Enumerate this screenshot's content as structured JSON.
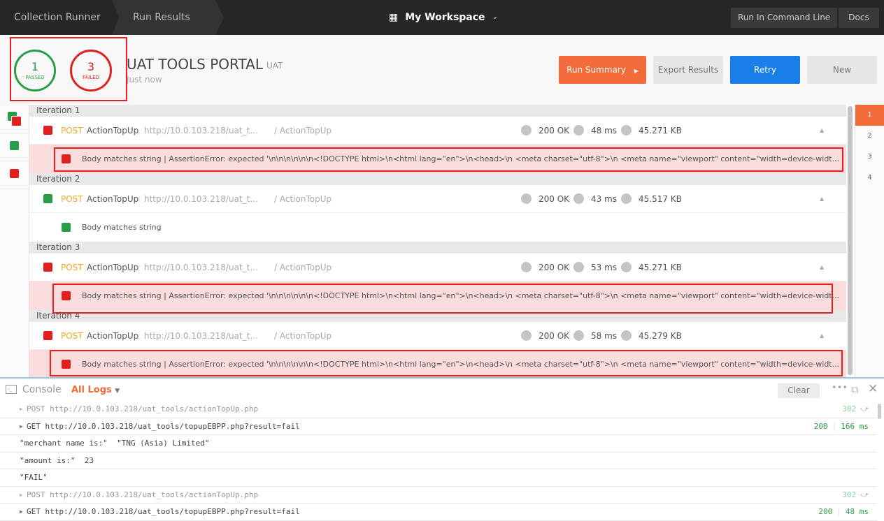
{
  "topbar": {
    "crumbs": [
      "Collection Runner",
      "Run Results"
    ],
    "workspace": "My Workspace",
    "run_cmd": "Run In Command Line",
    "docs": "Docs"
  },
  "summary": {
    "passed": "1",
    "passed_label": "PASSED",
    "failed": "3",
    "failed_label": "FAILED",
    "title": "UAT TOOLS PORTAL",
    "env": "UAT",
    "time": "Just now"
  },
  "buttons": {
    "run_summary": "Run Summary",
    "export": "Export Results",
    "retry": "Retry",
    "new": "New"
  },
  "colors": {
    "accent": "#f26b3a",
    "pass": "#2a9d4a",
    "fail": "#e0201e",
    "retry": "#1a7ee8",
    "method": "#f5a623"
  },
  "iterations": [
    {
      "label": "Iteration 1",
      "status": "fail",
      "method": "POST",
      "name": "ActionTopUp",
      "url": "http://10.0.103.218/uat_t...",
      "path": "/ ActionTopUp",
      "code": "200 OK",
      "time": "48 ms",
      "size": "45.271 KB",
      "test": "Body matches string | AssertionError: expected '\\n\\n\\n\\n\\n\\n<!DOCTYPE html>\\n<html lang=\"en\">\\n<head>\\n <meta charset=\"utf-8\">\\n <meta name=\"viewport\" content=\"width=device-widt..."
    },
    {
      "label": "Iteration 2",
      "status": "pass",
      "method": "POST",
      "name": "ActionTopUp",
      "url": "http://10.0.103.218/uat_t...",
      "path": "/ ActionTopUp",
      "code": "200 OK",
      "time": "43 ms",
      "size": "45.517 KB",
      "test": "Body matches string"
    },
    {
      "label": "Iteration 3",
      "status": "fail",
      "method": "POST",
      "name": "ActionTopUp",
      "url": "http://10.0.103.218/uat_t...",
      "path": "/ ActionTopUp",
      "code": "200 OK",
      "time": "53 ms",
      "size": "45.271 KB",
      "test": "Body matches string | AssertionError: expected '\\n\\n\\n\\n\\n\\n<!DOCTYPE html>\\n<html lang=\"en\">\\n<head>\\n <meta charset=\"utf-8\">\\n <meta name=\"viewport\" content=\"width=device-widt..."
    },
    {
      "label": "Iteration 4",
      "status": "fail",
      "method": "POST",
      "name": "ActionTopUp",
      "url": "http://10.0.103.218/uat_t...",
      "path": "/ ActionTopUp",
      "code": "200 OK",
      "time": "58 ms",
      "size": "45.279 KB",
      "test": "Body matches string | AssertionError: expected '\\n\\n\\n\\n\\n\\n<!DOCTYPE html>\\n<html lang=\"en\">\\n<head>\\n <meta charset=\"utf-8\">\\n <meta name=\"viewport\" content=\"width=device-widt..."
    }
  ],
  "iteration_nav": [
    "1",
    "2",
    "3",
    "4"
  ],
  "console": {
    "title": "Console",
    "filter": "All Logs",
    "clear": "Clear",
    "rows": [
      {
        "type": "req",
        "faded": true,
        "text": "POST http://10.0.103.218/uat_tools/actionTopUp.php",
        "status": "302",
        "time": ""
      },
      {
        "type": "req",
        "faded": false,
        "text": "GET http://10.0.103.218/uat_tools/topupEBPP.php?result=fail",
        "status": "200",
        "time": "166 ms"
      },
      {
        "type": "msg",
        "text": "\"merchant name is:\"  \"TNG (Asia) Limited\""
      },
      {
        "type": "msg",
        "text": "\"amount is:\"  23"
      },
      {
        "type": "msg",
        "text": "\"FAIL\""
      },
      {
        "type": "req",
        "faded": true,
        "text": "POST http://10.0.103.218/uat_tools/actionTopUp.php",
        "status": "302",
        "time": ""
      },
      {
        "type": "req",
        "faded": false,
        "text": "GET http://10.0.103.218/uat_tools/topupEBPP.php?result=fail",
        "status": "200",
        "time": "48 ms"
      }
    ]
  }
}
